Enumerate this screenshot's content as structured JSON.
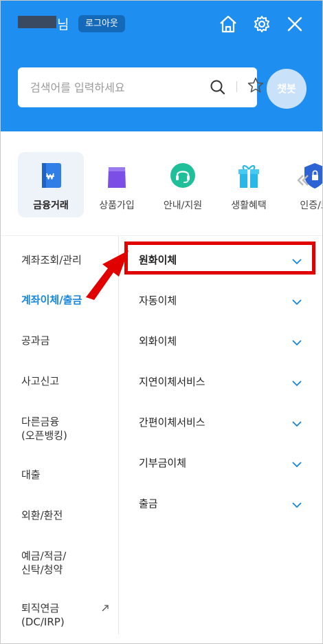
{
  "header": {
    "user_suffix": "님",
    "logout_label": "로그아웃",
    "icons": [
      "home-icon",
      "gear-icon",
      "close-icon"
    ],
    "background": "#1f8ef1"
  },
  "search": {
    "placeholder": "검색어를 입력하세요",
    "chatbot_label": "챗봇"
  },
  "categories": [
    {
      "label": "금융거래",
      "icon": "won-card-icon",
      "active": true
    },
    {
      "label": "상품가입",
      "icon": "shopping-bag-icon",
      "active": false
    },
    {
      "label": "안내/지원",
      "icon": "headset-icon",
      "active": false
    },
    {
      "label": "생활혜택",
      "icon": "gift-icon",
      "active": false
    },
    {
      "label": "인증/보",
      "icon": "shield-icon",
      "active": false
    }
  ],
  "left_menu": [
    {
      "label": "계좌조회/관리",
      "active": false
    },
    {
      "label": "계좌이체/출금",
      "active": true
    },
    {
      "label": "공과금",
      "active": false
    },
    {
      "label": "사고신고",
      "active": false
    },
    {
      "label": "다른금융",
      "label2": "(오픈뱅킹)",
      "active": false
    },
    {
      "label": "대출",
      "active": false
    },
    {
      "label": "외환/환전",
      "active": false
    },
    {
      "label": "예금/적금/",
      "label2": "신탁/청약",
      "active": false
    },
    {
      "label": "퇴직연금",
      "label2": "(DC/IRP)",
      "active": false,
      "external": true
    }
  ],
  "right_menu": [
    {
      "label": "원화이체",
      "highlighted": true
    },
    {
      "label": "자동이체"
    },
    {
      "label": "외화이체"
    },
    {
      "label": "지연이체서비스"
    },
    {
      "label": "간편이체서비스"
    },
    {
      "label": "기부금이체"
    },
    {
      "label": "출금"
    }
  ],
  "colors": {
    "accent": "#1685de",
    "annotation": "#e00000"
  }
}
